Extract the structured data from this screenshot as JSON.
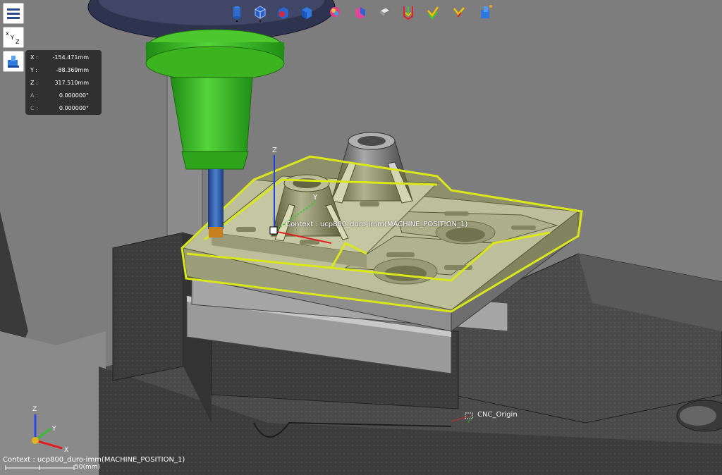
{
  "toolbar": {
    "icons": [
      "cylinder-view-icon",
      "wireframe-cube-icon",
      "stock-cube-icon",
      "solid-cube-icon",
      "color-sphere-icon",
      "section-cube-icon",
      "material-removal-icon",
      "toolpath-down-icon",
      "toolpath-check-icon",
      "toolpath-arrow-icon",
      "simulation-machine-icon"
    ]
  },
  "left_tools": {
    "menu": "menu-icon",
    "axes": "xyz-axes-icon",
    "machine": "machine-view-icon"
  },
  "coordinates": [
    {
      "axis": "X :",
      "value": "-154.471mm",
      "active": true
    },
    {
      "axis": "Y :",
      "value": "-88.369mm",
      "active": true
    },
    {
      "axis": "Z :",
      "value": "317.510mm",
      "active": true
    },
    {
      "axis": "A :",
      "value": "0.000000°",
      "active": false
    },
    {
      "axis": "C :",
      "value": "0.000000°",
      "active": false
    }
  ],
  "scene": {
    "context_label": "Context : ucp800_duro-imm(MACHINE_POSITION_1)",
    "cnc_origin_label": "CNC_Origin"
  },
  "status": {
    "context": "Context : ucp800_duro-imm(MACHINE_POSITION_1)",
    "scale": "50(mm)"
  },
  "colors": {
    "background": "#7c7c7c",
    "highlight": "#d9e81a",
    "spindle_green": "#35b81e",
    "tool_blue": "#2d5aa8",
    "vise": "#3e3e3e"
  }
}
